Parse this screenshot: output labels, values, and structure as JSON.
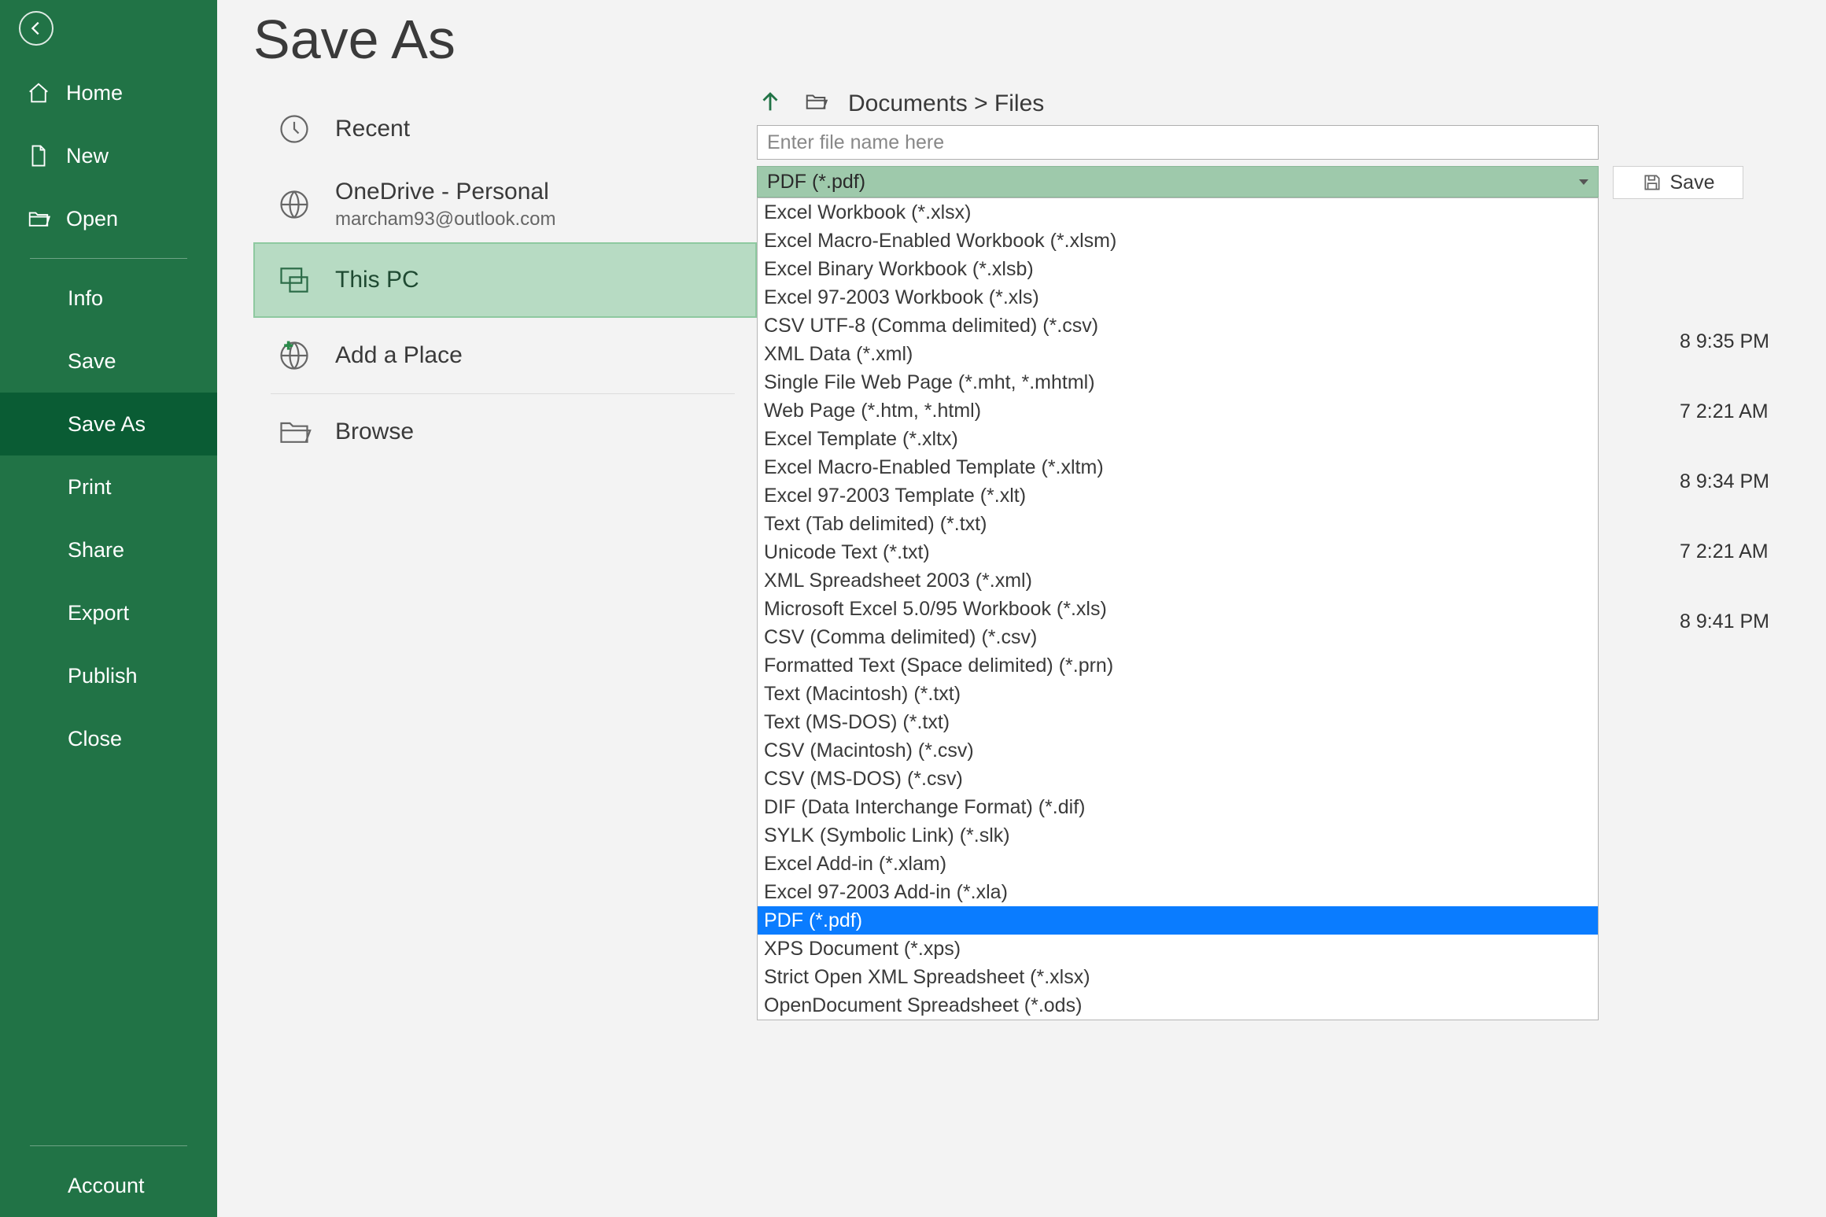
{
  "sidebar": {
    "home": "Home",
    "new": "New",
    "open": "Open",
    "info": "Info",
    "save": "Save",
    "save_as": "Save As",
    "print": "Print",
    "share": "Share",
    "export": "Export",
    "publish": "Publish",
    "close": "Close",
    "account": "Account"
  },
  "page": {
    "title": "Save As"
  },
  "locations": {
    "recent": "Recent",
    "onedrive": {
      "name": "OneDrive - Personal",
      "email": "marcham93@outlook.com"
    },
    "this_pc": "This PC",
    "add_place": "Add a Place",
    "browse": "Browse"
  },
  "path": {
    "breadcrumb": "Documents > Files"
  },
  "filename": {
    "placeholder": "Enter file name here",
    "value": ""
  },
  "filetype": {
    "selected": "PDF (*.pdf)",
    "options": [
      "Excel Workbook (*.xlsx)",
      "Excel Macro-Enabled Workbook (*.xlsm)",
      "Excel Binary Workbook (*.xlsb)",
      "Excel 97-2003 Workbook (*.xls)",
      "CSV UTF-8 (Comma delimited) (*.csv)",
      "XML Data (*.xml)",
      "Single File Web Page (*.mht, *.mhtml)",
      "Web Page (*.htm, *.html)",
      "Excel Template (*.xltx)",
      "Excel Macro-Enabled Template (*.xltm)",
      "Excel 97-2003 Template (*.xlt)",
      "Text (Tab delimited) (*.txt)",
      "Unicode Text (*.txt)",
      "XML Spreadsheet 2003 (*.xml)",
      "Microsoft Excel 5.0/95 Workbook (*.xls)",
      "CSV (Comma delimited) (*.csv)",
      "Formatted Text (Space delimited) (*.prn)",
      "Text (Macintosh) (*.txt)",
      "Text (MS-DOS) (*.txt)",
      "CSV (Macintosh) (*.csv)",
      "CSV (MS-DOS) (*.csv)",
      "DIF (Data Interchange Format) (*.dif)",
      "SYLK (Symbolic Link) (*.slk)",
      "Excel Add-in (*.xlam)",
      "Excel 97-2003 Add-in (*.xla)",
      "PDF (*.pdf)",
      "XPS Document (*.xps)",
      "Strict Open XML Spreadsheet (*.xlsx)",
      "OpenDocument Spreadsheet (*.ods)"
    ],
    "highlighted_index": 25
  },
  "save_button": "Save",
  "visible_timestamps": [
    "8 9:35 PM",
    "7 2:21 AM",
    "8 9:34 PM",
    "7 2:21 AM",
    "8 9:41 PM"
  ]
}
